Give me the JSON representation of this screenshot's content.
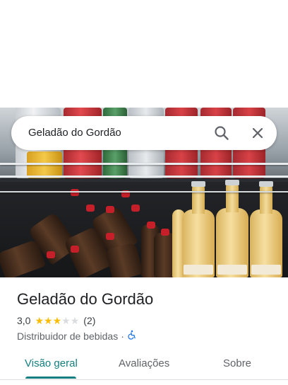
{
  "search": {
    "query": "Geladão do Gordão",
    "search_icon": "search-icon",
    "clear_icon": "close-icon"
  },
  "place": {
    "name": "Geladão do Gordão",
    "rating": "3,0",
    "stars_filled": 3,
    "stars_total": 5,
    "review_count": "(2)",
    "category": "Distribuidor de bebidas",
    "separator": "·",
    "accessibility_icon": "wheelchair-icon"
  },
  "tabs": [
    {
      "label": "Visão geral",
      "active": true
    },
    {
      "label": "Avaliações",
      "active": false
    },
    {
      "label": "Sobre",
      "active": false
    }
  ],
  "colors": {
    "accent": "#137f80",
    "star": "#fbbc04",
    "star_empty": "#dadce0",
    "accessibility": "#1a73e8"
  }
}
